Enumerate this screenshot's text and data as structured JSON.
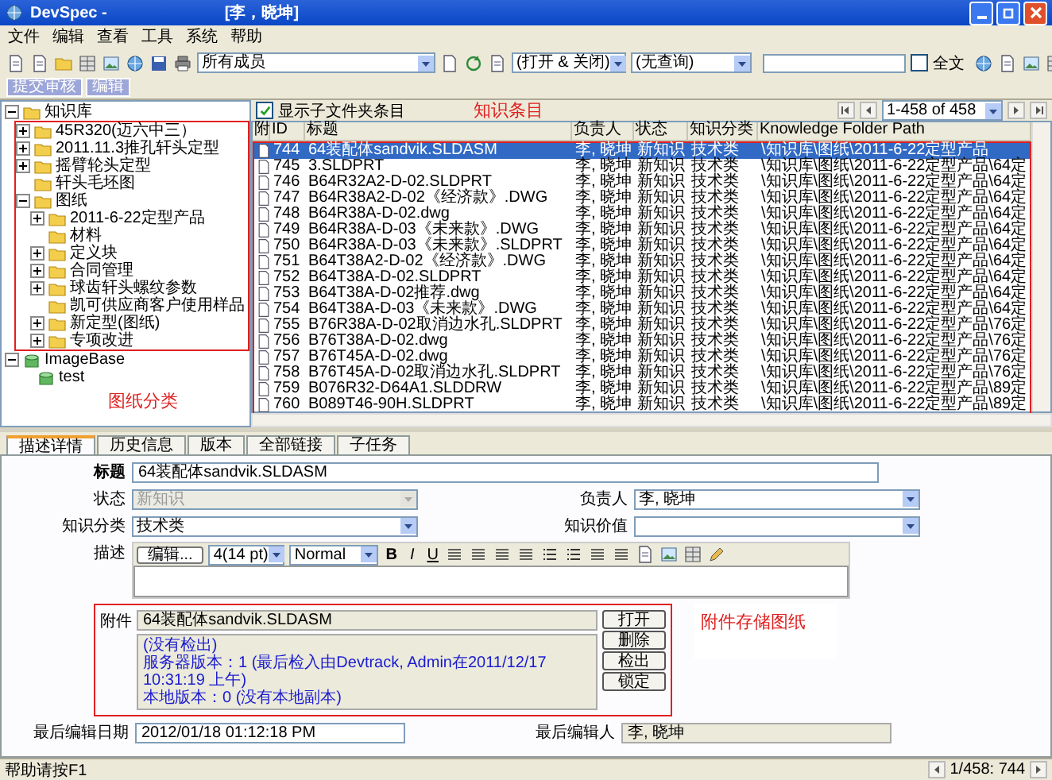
{
  "window": {
    "title": "DevSpec -",
    "user": "[李，晓坤]"
  },
  "menu": [
    "文件",
    "编辑",
    "查看",
    "工具",
    "系统",
    "帮助"
  ],
  "toolbar": {
    "member_filter": "所有成员",
    "state_filter": "(打开 & 关闭)",
    "query_filter": "(无查询)",
    "fulltext": {
      "label": "全文",
      "checked": false
    }
  },
  "action_buttons": [
    "提交审核",
    "编辑"
  ],
  "tree": [
    {
      "label": "知识库",
      "kind": "folder",
      "expanded": true,
      "children": [
        {
          "label": "45R320(迈六中三）",
          "kind": "folder",
          "expanded": false
        },
        {
          "label": "2011.11.3推孔轩头定型",
          "kind": "folder",
          "expanded": false
        },
        {
          "label": "摇臂轮头定型",
          "kind": "folder",
          "expanded": false
        },
        {
          "label": "轩头毛坯图",
          "kind": "folder"
        },
        {
          "label": "图纸",
          "kind": "folder",
          "expanded": true,
          "children": [
            {
              "label": "2011-6-22定型产品",
              "kind": "folder",
              "expanded": false
            },
            {
              "label": "材料",
              "kind": "folder"
            },
            {
              "label": "定义块",
              "kind": "folder",
              "expanded": false
            },
            {
              "label": "合同管理",
              "kind": "folder",
              "expanded": false
            },
            {
              "label": "球齿轩头螺纹参数",
              "kind": "folder",
              "expanded": false
            },
            {
              "label": "凯可供应商客户使用样品",
              "kind": "folder"
            },
            {
              "label": "新定型(图纸)",
              "kind": "folder",
              "expanded": false
            },
            {
              "label": "专项改进",
              "kind": "folder",
              "expanded": false
            }
          ]
        }
      ]
    },
    {
      "label": "ImageBase",
      "kind": "database",
      "expanded": true,
      "children": [
        {
          "label": "test",
          "kind": "database"
        }
      ]
    }
  ],
  "tree_annotation": "图纸分类",
  "list": {
    "show_subfolders": {
      "label": "显示子文件夹条目",
      "checked": true
    },
    "annotation": "知识条目",
    "pager": "1-458 of 458",
    "columns": [
      "附",
      "ID",
      "标题",
      "负责人",
      "状态",
      "知识分类",
      "Knowledge Folder Path"
    ],
    "rows": [
      {
        "id": "744",
        "title": "64装配体sandvik.SLDASM",
        "owner": "李, 晓坤",
        "status": "新知识",
        "category": "技术类",
        "path": "\\知识库\\图纸\\2011-6-22定型产品",
        "selected": true
      },
      {
        "id": "745",
        "title": "3.SLDPRT",
        "owner": "李, 晓坤",
        "status": "新知识",
        "category": "技术类",
        "path": "\\知识库\\图纸\\2011-6-22定型产品\\64定",
        "selected": false
      },
      {
        "id": "746",
        "title": "B64R32A2-D-02.SLDPRT",
        "owner": "李, 晓坤",
        "status": "新知识",
        "category": "技术类",
        "path": "\\知识库\\图纸\\2011-6-22定型产品\\64定",
        "selected": false
      },
      {
        "id": "747",
        "title": "B64R38A2-D-02《经济款》.DWG",
        "owner": "李, 晓坤",
        "status": "新知识",
        "category": "技术类",
        "path": "\\知识库\\图纸\\2011-6-22定型产品\\64定",
        "selected": false
      },
      {
        "id": "748",
        "title": "B64R38A-D-02.dwg",
        "owner": "李, 晓坤",
        "status": "新知识",
        "category": "技术类",
        "path": "\\知识库\\图纸\\2011-6-22定型产品\\64定",
        "selected": false
      },
      {
        "id": "749",
        "title": "B64R38A-D-03《未来款》.DWG",
        "owner": "李, 晓坤",
        "status": "新知识",
        "category": "技术类",
        "path": "\\知识库\\图纸\\2011-6-22定型产品\\64定",
        "selected": false
      },
      {
        "id": "750",
        "title": "B64R38A-D-03《未来款》.SLDPRT",
        "owner": "李, 晓坤",
        "status": "新知识",
        "category": "技术类",
        "path": "\\知识库\\图纸\\2011-6-22定型产品\\64定",
        "selected": false
      },
      {
        "id": "751",
        "title": "B64T38A2-D-02《经济款》.DWG",
        "owner": "李, 晓坤",
        "status": "新知识",
        "category": "技术类",
        "path": "\\知识库\\图纸\\2011-6-22定型产品\\64定",
        "selected": false
      },
      {
        "id": "752",
        "title": "B64T38A-D-02.SLDPRT",
        "owner": "李, 晓坤",
        "status": "新知识",
        "category": "技术类",
        "path": "\\知识库\\图纸\\2011-6-22定型产品\\64定",
        "selected": false
      },
      {
        "id": "753",
        "title": "B64T38A-D-02推荐.dwg",
        "owner": "李, 晓坤",
        "status": "新知识",
        "category": "技术类",
        "path": "\\知识库\\图纸\\2011-6-22定型产品\\64定",
        "selected": false
      },
      {
        "id": "754",
        "title": "B64T38A-D-03《未来款》.DWG",
        "owner": "李, 晓坤",
        "status": "新知识",
        "category": "技术类",
        "path": "\\知识库\\图纸\\2011-6-22定型产品\\64定",
        "selected": false
      },
      {
        "id": "755",
        "title": "B76R38A-D-02取消边水孔.SLDPRT",
        "owner": "李, 晓坤",
        "status": "新知识",
        "category": "技术类",
        "path": "\\知识库\\图纸\\2011-6-22定型产品\\76定",
        "selected": false
      },
      {
        "id": "756",
        "title": "B76T38A-D-02.dwg",
        "owner": "李, 晓坤",
        "status": "新知识",
        "category": "技术类",
        "path": "\\知识库\\图纸\\2011-6-22定型产品\\76定",
        "selected": false
      },
      {
        "id": "757",
        "title": "B76T45A-D-02.dwg",
        "owner": "李, 晓坤",
        "status": "新知识",
        "category": "技术类",
        "path": "\\知识库\\图纸\\2011-6-22定型产品\\76定",
        "selected": false
      },
      {
        "id": "758",
        "title": "B76T45A-D-02取消边水孔.SLDPRT",
        "owner": "李, 晓坤",
        "status": "新知识",
        "category": "技术类",
        "path": "\\知识库\\图纸\\2011-6-22定型产品\\76定",
        "selected": false
      },
      {
        "id": "759",
        "title": "B076R32-D64A1.SLDDRW",
        "owner": "李, 晓坤",
        "status": "新知识",
        "category": "技术类",
        "path": "\\知识库\\图纸\\2011-6-22定型产品\\89定",
        "selected": false
      },
      {
        "id": "760",
        "title": "B089T46-90H.SLDPRT",
        "owner": "李, 晓坤",
        "status": "新知识",
        "category": "技术类",
        "path": "\\知识库\\图纸\\2011-6-22定型产品\\89定",
        "selected": false
      }
    ]
  },
  "detail": {
    "tabs": [
      {
        "label": "描述详情",
        "selected": true
      },
      {
        "label": "历史信息",
        "selected": false
      },
      {
        "label": "版本",
        "selected": false
      },
      {
        "label": "全部链接",
        "selected": false
      },
      {
        "label": "子任务",
        "selected": false
      }
    ],
    "title": {
      "label": "标题",
      "value": "64装配体sandvik.SLDASM"
    },
    "status": {
      "label": "状态",
      "value": "新知识",
      "disabled": true
    },
    "owner": {
      "label": "负责人",
      "value": "李, 晓坤"
    },
    "category": {
      "label": "知识分类",
      "value": "技术类"
    },
    "value_field": {
      "label": "知识价值"
    },
    "description": {
      "label": "描述",
      "edit_button": "编辑...",
      "font_size": "4(14 pt)",
      "format": "Normal",
      "bold": "B",
      "italic": "I",
      "underline": "U"
    },
    "attachment": {
      "label": "附件",
      "file": "64装配体sandvik.SLDASM",
      "info": [
        "(没有检出)",
        "服务器版本：1 (最后检入由Devtrack, Admin在2011/12/17 10:31:19 上午)",
        "本地版本：0 (没有本地副本)"
      ],
      "buttons": [
        "打开",
        "删除",
        "检出",
        "锁定"
      ],
      "annotation": "附件存储图纸"
    },
    "last_edit_date": {
      "label": "最后编辑日期",
      "value": "2012/01/18 01:12:18 PM"
    },
    "last_editor": {
      "label": "最后编辑人",
      "value": "李, 晓坤"
    }
  },
  "status_bar": {
    "help": "帮助请按F1",
    "record": "1/458: 744"
  }
}
